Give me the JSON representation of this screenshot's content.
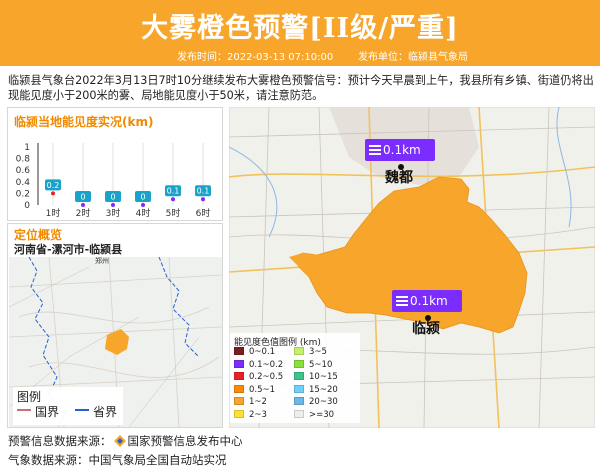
{
  "header": {
    "title": "大雾橙色预警[II级/严重]",
    "publish_time": "发布时间：2022-03-13 07:10:00",
    "publisher": "发布单位：临颍县气象局"
  },
  "intro": "临颍县气象台2022年3月13日7时10分继续发布大雾橙色预警信号：预计今天早晨到上午，我县所有乡镇、街道仍将出现能见度小于200米的雾、局地能见度小于50米，请注意防范。",
  "visibility_panel": {
    "title": "临颍当地能见度实况(km)"
  },
  "chart_data": {
    "type": "bar",
    "title": "临颍当地能见度实况(km)",
    "categories": [
      "1时",
      "2时",
      "3时",
      "4时",
      "5时",
      "6时"
    ],
    "values": [
      0.2,
      0,
      0,
      0,
      0.1,
      0.1
    ],
    "value_labels": [
      "0.2",
      "0",
      "0",
      "0",
      "0.1",
      "0.1"
    ],
    "y_ticks": [
      "1",
      "0.8",
      "0.6",
      "0.4",
      "0.2",
      "0"
    ],
    "ylim": [
      0,
      1
    ],
    "grid": false
  },
  "location_panel": {
    "title": "定位概览",
    "subtitle": "河南省-漯河市-临颍县",
    "map_city_label": "郑州",
    "legend_title": "图例",
    "legend_items": [
      {
        "label": "国界",
        "color": "#c8707a"
      },
      {
        "label": "省界",
        "color": "#2a5fd0"
      }
    ]
  },
  "map": {
    "cities": [
      {
        "name": "魏都",
        "visibility": "0.1km"
      },
      {
        "name": "临颍",
        "visibility": "0.1km"
      }
    ],
    "fog_color": "#f7a52b",
    "label_color": "#7b2cff",
    "legend_title": "能见度色值图例 (km)",
    "legend": [
      {
        "label": "0~0.1",
        "color": "#7a1f1f"
      },
      {
        "label": "0.1~0.2",
        "color": "#7b2cff"
      },
      {
        "label": "0.2~0.5",
        "color": "#e8202a"
      },
      {
        "label": "0.5~1",
        "color": "#ff8a00"
      },
      {
        "label": "1~2",
        "color": "#f7a52b"
      },
      {
        "label": "2~3",
        "color": "#ffe033"
      },
      {
        "label": "3~5",
        "color": "#c6f06a"
      },
      {
        "label": "5~10",
        "color": "#88e03a"
      },
      {
        "label": "10~15",
        "color": "#3fc48c"
      },
      {
        "label": "15~20",
        "color": "#6fd0ff"
      },
      {
        "label": "20~30",
        "color": "#6ab7e8"
      },
      {
        "label": ">=30",
        "color": "#eeeeee"
      }
    ]
  },
  "footer": {
    "warning_source": "预警信息数据来源：",
    "warning_source_name": "国家预警信息发布中心",
    "weather_source": "气象数据来源：中国气象局全国自动站实况"
  }
}
